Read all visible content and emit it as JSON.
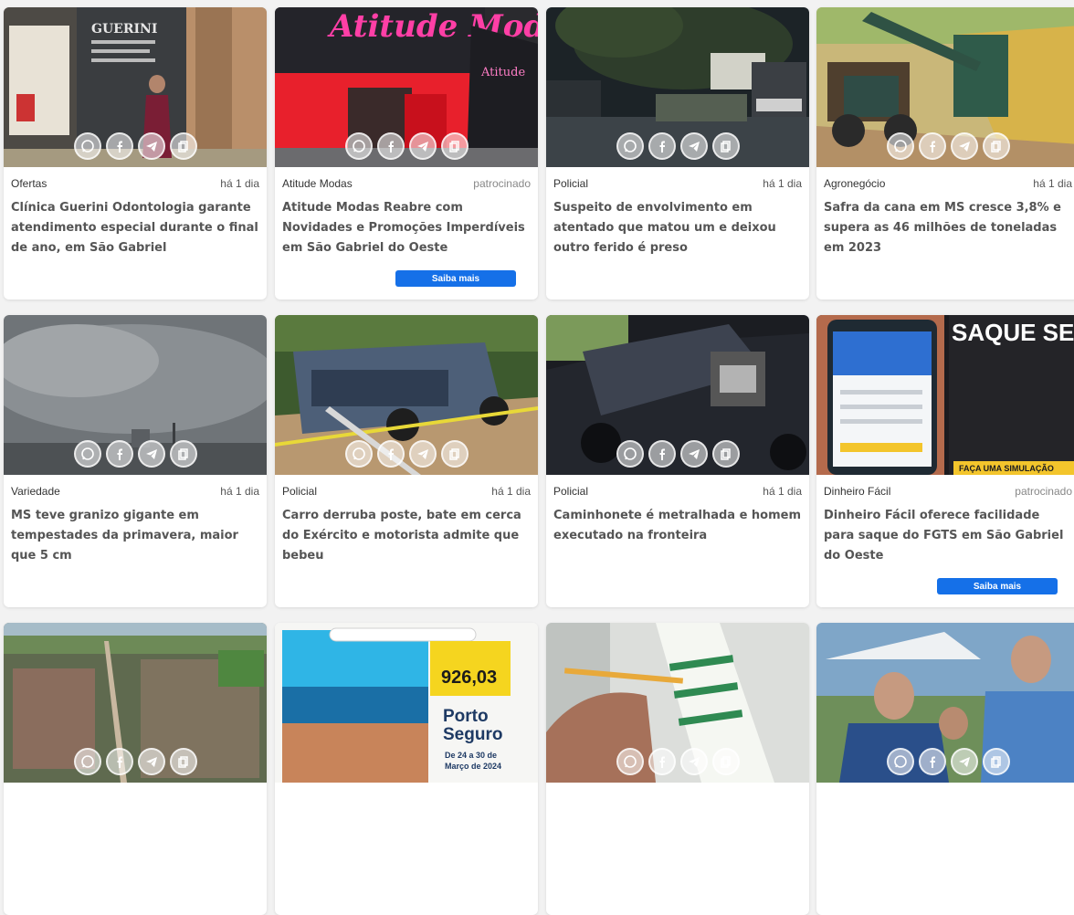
{
  "share_icons": [
    "whatsapp-icon",
    "facebook-icon",
    "telegram-icon",
    "copy-link-icon"
  ],
  "colors": {
    "cta_blue": "#1570e8",
    "card_bg": "#ffffff",
    "page_bg": "#f2f2f2",
    "title_gray": "#555555"
  },
  "cards": [
    {
      "category": "Ofertas",
      "time": "há 1 dia",
      "title": "Clínica Guerini Odontologia garante atendimento especial durante o final de ano, em São Gabriel",
      "image": "storefront-photo",
      "image_text": "GUERINI"
    },
    {
      "category": "Atitude Modas",
      "time": "patrocinado",
      "title": "Atitude Modas Reabre com Novidades e Promoções Imperdíveis em São Gabriel do Oeste",
      "cta": "Saiba mais",
      "image": "store-facade-photo",
      "image_text": "Atitude Modas"
    },
    {
      "category": "Policial",
      "time": "há 1 dia",
      "title": "Suspeito de envolvimento em atentado que matou um e deixou outro ferido é preso",
      "image": "police-night-photo"
    },
    {
      "category": "Agronegócio",
      "time": "há 1 dia",
      "title": "Safra da cana em MS cresce 3,8% e supera as 46 milhões de toneladas em 2023",
      "image": "sugarcane-harvest-photo"
    },
    {
      "category": "Variedade",
      "time": "há 1 dia",
      "title": "MS teve granizo gigante em tempestades da primavera, maior que 5 cm",
      "image": "storm-clouds-photo"
    },
    {
      "category": "Policial",
      "time": "há 1 dia",
      "title": "Carro derruba poste, bate em cerca do Exército e motorista admite que bebeu",
      "image": "crashed-car-photo"
    },
    {
      "category": "Policial",
      "time": "há 1 dia",
      "title": "Caminhonete é metralhada e homem executado na fronteira",
      "image": "shot-truck-photo"
    },
    {
      "category": "Dinheiro Fácil",
      "time": "patrocinado",
      "title": "Dinheiro Fácil oferece facilidade para saque do FGTS em São Gabriel do Oeste",
      "cta": "Saiba mais",
      "image": "fgts-ad",
      "image_text": "SAQUE SEU FGTS",
      "image_subtext": "FAÇA UMA SIMULAÇÃO"
    },
    {
      "image": "aerial-city-photo"
    },
    {
      "image": "travel-ad",
      "image_text": "Porto Seguro",
      "image_subtext": "De 24 a 30 de Março de 2024",
      "image_price": "926,03"
    },
    {
      "image": "lottery-ticket-photo"
    },
    {
      "image": "event-people-photo"
    }
  ]
}
